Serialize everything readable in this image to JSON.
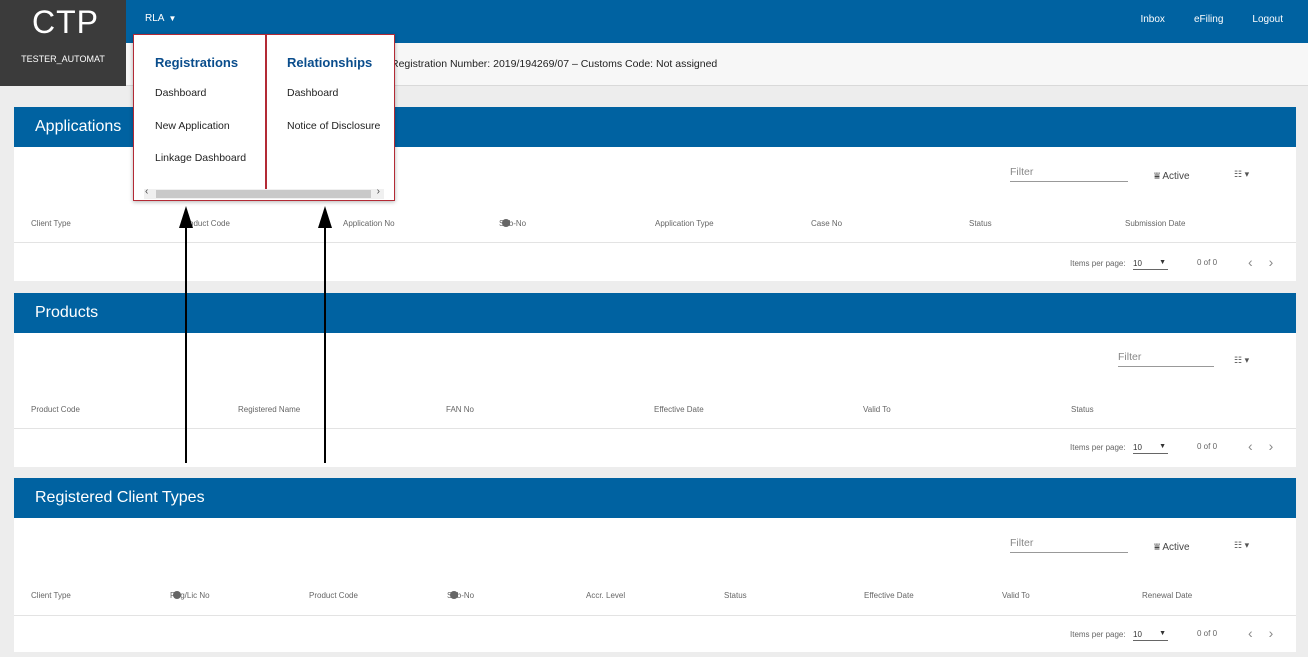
{
  "brand": {
    "logo": "CTP",
    "user": "TESTER_AUTOMAT"
  },
  "topnav": {
    "menu_label": "RLA",
    "links": [
      "Inbox",
      "eFiling",
      "Logout"
    ]
  },
  "infobar": {
    "text": "Registration Number: 2019/194269/07 – Customs Code: Not assigned"
  },
  "dropdown": {
    "registrations": {
      "heading": "Registrations",
      "items": [
        "Dashboard",
        "New Application",
        "Linkage Dashboard"
      ]
    },
    "relationships": {
      "heading": "Relationships",
      "items": [
        "Dashboard",
        "Notice of Disclosure"
      ]
    }
  },
  "applications": {
    "title": "Applications",
    "filter_placeholder": "Filter",
    "active_label": "Active",
    "columns": [
      "Client Type",
      "Product Code",
      "Application No",
      "Sub-No",
      "Application Type",
      "Case No",
      "Status",
      "Submission Date"
    ],
    "items_per_page_label": "Items per page:",
    "items_per_page": "10",
    "range": "0 of 0"
  },
  "products": {
    "title": "Products",
    "filter_placeholder": "Filter",
    "columns": [
      "Product Code",
      "Registered Name",
      "FAN No",
      "Effective Date",
      "Valid To",
      "Status"
    ],
    "items_per_page_label": "Items per page:",
    "items_per_page": "10",
    "range": "0 of 0"
  },
  "client_types": {
    "title": "Registered Client Types",
    "filter_placeholder": "Filter",
    "active_label": "Active",
    "columns": [
      "Client Type",
      "Reg/Lic No",
      "Product Code",
      "Sub-No",
      "Accr. Level",
      "Status",
      "Effective Date",
      "Valid To",
      "Renewal Date"
    ],
    "items_per_page_label": "Items per page:",
    "items_per_page": "10",
    "range": "0 of 0"
  },
  "colors": {
    "primary": "#0062a1",
    "brand_bg": "#3b3b3b",
    "highlight": "#b32a35"
  }
}
